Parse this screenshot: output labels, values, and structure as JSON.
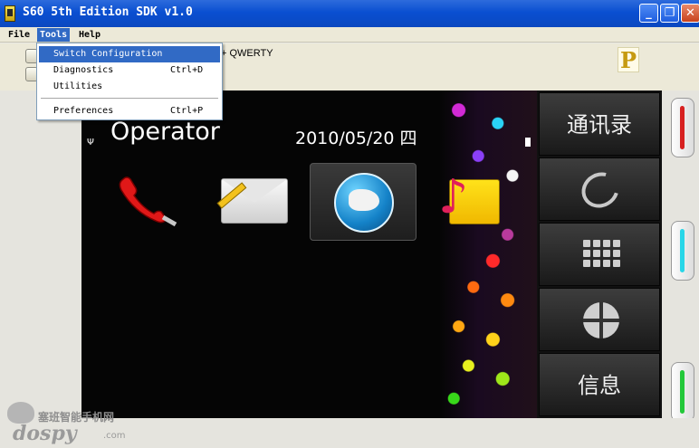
{
  "window": {
    "title": "S60 5th Edition SDK v1.0",
    "minimize_glyph": "_",
    "maximize_glyph": "❐",
    "close_glyph": "✕"
  },
  "menubar": {
    "file": "File",
    "tools": "Tools",
    "help": "Help"
  },
  "tools_menu": {
    "items": [
      {
        "label": "Switch Configuration",
        "shortcut": ""
      },
      {
        "label": "Diagnostics",
        "shortcut": "Ctrl+D"
      },
      {
        "label": "Utilities",
        "shortcut": ""
      },
      {
        "label": "Preferences",
        "shortcut": "Ctrl+P"
      }
    ]
  },
  "toolbar": {
    "configuration_text": "+ QWERTY",
    "logo_letter": "P"
  },
  "phone": {
    "signal_glyph": "Ψ",
    "operator": "Operator",
    "datetime": "2010/05/20 四",
    "softkeys": {
      "contacts": "通讯录",
      "messages": "信息"
    },
    "apps": [
      "phone-icon",
      "mail-icon",
      "web-browser-icon",
      "music-icon"
    ]
  },
  "watermark": {
    "chinese": "塞班智能手机网",
    "brand": "dospy",
    "suffix": ".com"
  },
  "colors": {
    "titlebar": "#0a4fd1",
    "menu_highlight": "#316ac5",
    "hw_red": "#d72020",
    "hw_cyan": "#28d6e8",
    "hw_green": "#23c83a"
  }
}
